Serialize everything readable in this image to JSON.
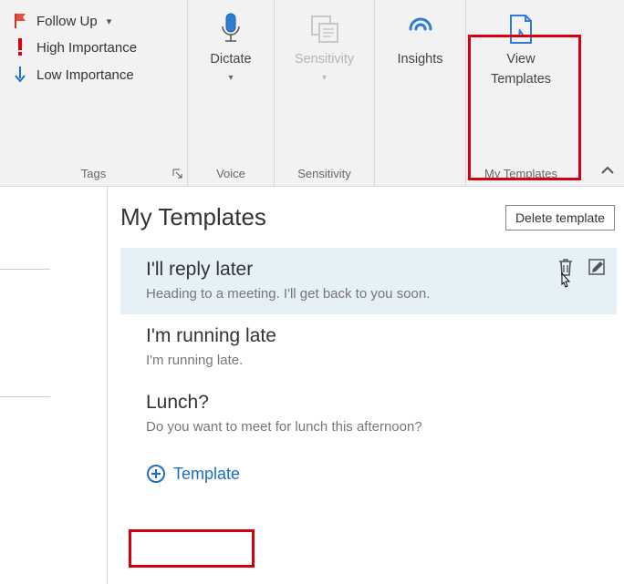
{
  "ribbon": {
    "tags": {
      "follow_up": "Follow Up",
      "high": "High Importance",
      "low": "Low Importance",
      "group_label": "Tags"
    },
    "dictate": {
      "label": "Dictate",
      "group_label": "Voice"
    },
    "sensitivity": {
      "label": "Sensitivity",
      "group_label": "Sensitivity"
    },
    "insights": {
      "label": "Insights"
    },
    "view_templates": {
      "line1": "View",
      "line2": "Templates",
      "group_label": "My Templates"
    }
  },
  "pane": {
    "title": "My Templates",
    "delete_label": "Delete template",
    "templates": [
      {
        "title": "I'll reply later",
        "body": "Heading to a meeting. I'll get back to you soon."
      },
      {
        "title": "I'm running late",
        "body": "I'm running late."
      },
      {
        "title": "Lunch?",
        "body": "Do you want to meet for lunch this afternoon?"
      }
    ],
    "add_label": "Template"
  }
}
